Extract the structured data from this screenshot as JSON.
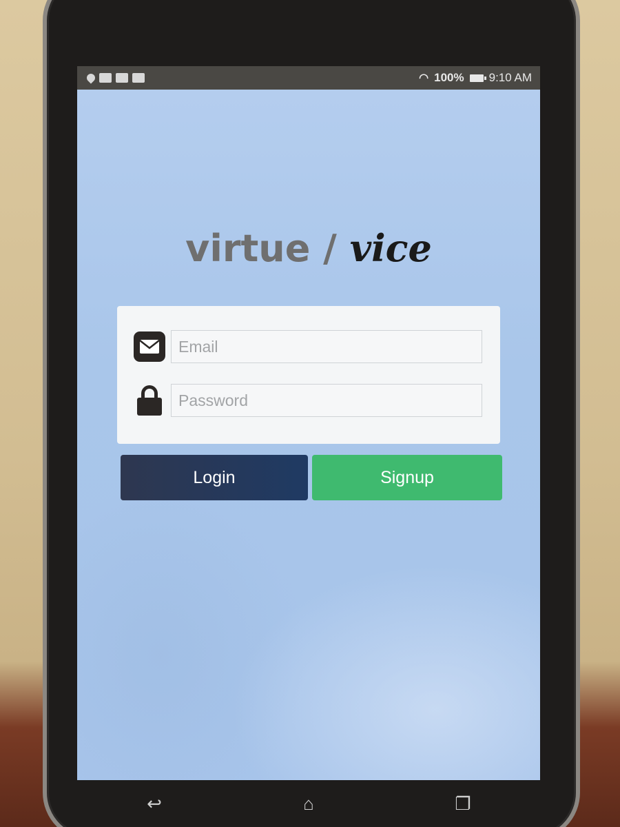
{
  "status_bar": {
    "battery": "100%",
    "time": "9:10 AM",
    "left_icons": [
      "location-icon",
      "gmail-icon",
      "gmail-icon",
      "gallery-icon"
    ],
    "right_icons": [
      "wifi-icon",
      "battery-icon"
    ]
  },
  "app": {
    "title_part1": "virtue",
    "title_separator": " / ",
    "title_part2": "vice"
  },
  "form": {
    "email_placeholder": "Email",
    "password_placeholder": "Password"
  },
  "buttons": {
    "login_label": "Login",
    "signup_label": "Signup"
  },
  "colors": {
    "login_button": "#1f3a63",
    "signup_button": "#3fba6f",
    "screen_background": "#aac7ea"
  },
  "nav_bar": {
    "back_glyph": "↩",
    "home_glyph": "⌂",
    "recents_glyph": "❐"
  }
}
